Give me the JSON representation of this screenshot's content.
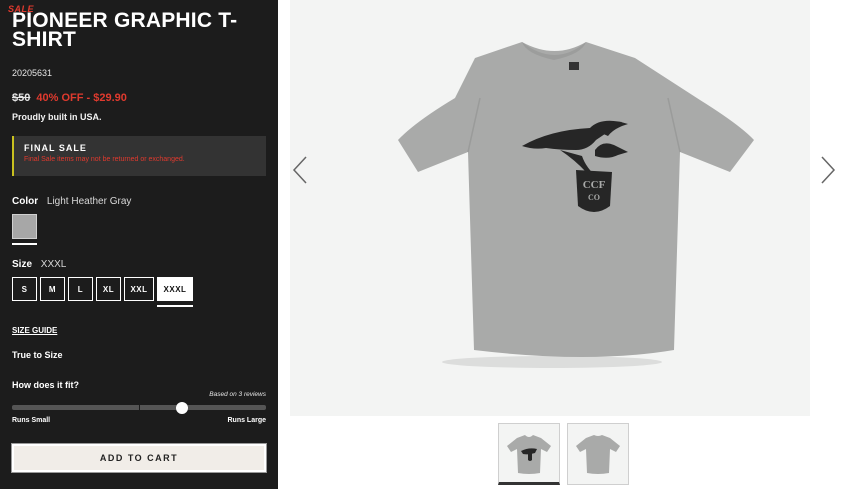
{
  "product": {
    "badge": "SALE",
    "title": "PIONEER GRAPHIC T-SHIRT",
    "sku": "20205631",
    "price_original": "$50",
    "discount_text": "40% OFF - $29.90",
    "origin_note": "Proudly built in USA."
  },
  "final_sale": {
    "title": "FINAL SALE",
    "note": "Final Sale items may not be returned or exchanged."
  },
  "color": {
    "label": "Color",
    "selected": "Light Heather Gray",
    "swatch_color": "#a7a7a7"
  },
  "size": {
    "label": "Size",
    "selected": "XXXL",
    "options": [
      "S",
      "M",
      "L",
      "XL",
      "XXL",
      "XXXL"
    ]
  },
  "size_guide": "SIZE GUIDE",
  "fit_summary": "True to Size",
  "fit": {
    "question": "How does it fit?",
    "reviews_note": "Based on 3 reviews",
    "min_label": "Runs Small",
    "max_label": "Runs Large",
    "value_fraction": 0.67
  },
  "cta": {
    "add_to_cart": "ADD TO CART"
  },
  "graphic": {
    "shield_text_1": "CCF",
    "shield_text_2": "CO"
  },
  "icons": {
    "prev": "chevron-left-icon",
    "next": "chevron-right-icon"
  },
  "colors": {
    "panel_bg": "#1c1c1c",
    "sale_red": "#e03a2e",
    "final_sale_accent": "#c9c11f",
    "shirt_gray": "#a9aaa9"
  }
}
